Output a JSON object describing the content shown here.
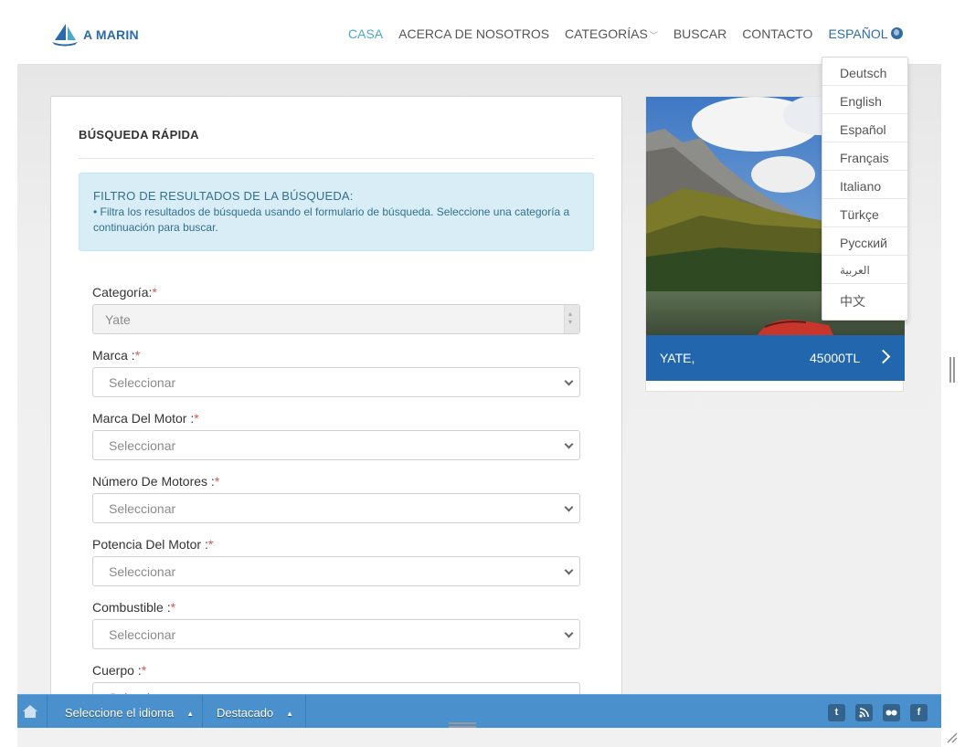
{
  "header": {
    "logo_text": "A MARIN",
    "nav": [
      {
        "label": "CASA",
        "active": true
      },
      {
        "label": "ACERCA DE NOSOTROS"
      },
      {
        "label": "CATEGORÍAS"
      },
      {
        "label": "BUSCAR"
      },
      {
        "label": "CONTACTO"
      },
      {
        "label": "ESPAÑOL"
      }
    ]
  },
  "languages": [
    "Deutsch",
    "English",
    "Español",
    "Français",
    "Italiano",
    "Türkçe",
    "Русский",
    "العربية",
    "中文"
  ],
  "search": {
    "title": "BÚSQUEDA RÁPIDA",
    "alert_title": "FILTRO DE RESULTADOS DE LA BÚSQUEDA:",
    "alert_body": "• Filtra los resultados de búsqueda usando el formulario de búsqueda. Seleccione una categoría a continuación para buscar.",
    "required_mark": "*",
    "fields": [
      {
        "label": "Categoría:",
        "value": "Yate"
      },
      {
        "label": "Marca :",
        "value": "Seleccionar"
      },
      {
        "label": "Marca Del Motor :",
        "value": "Seleccionar"
      },
      {
        "label": "Número De Motores :",
        "value": "Seleccionar"
      },
      {
        "label": "Potencia Del Motor :",
        "value": "Seleccionar"
      },
      {
        "label": "Combustible :",
        "value": "Seleccionar"
      },
      {
        "label": "Cuerpo :",
        "value": "Seleccionar"
      }
    ]
  },
  "listing": {
    "category": "YATE,",
    "price": "45000TL"
  },
  "toolbar": {
    "language_label": "Seleccione el idioma",
    "featured_label": "Destacado",
    "social": [
      "t",
      "rss",
      "flickr",
      "f"
    ]
  },
  "colors": {
    "accent_nav": "#4aa8c8",
    "brand_blue": "#2266ad",
    "toolbar_blue": "#4a90cc",
    "alert_bg": "#d9edf7",
    "required": "#d9534f"
  }
}
